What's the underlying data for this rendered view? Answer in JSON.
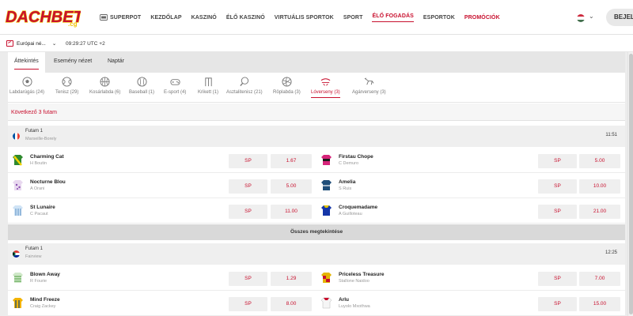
{
  "brand": {
    "logo_text": "DACHBET",
    "logo_suffix": ".cg",
    "accent": "#c8102e"
  },
  "nav": [
    {
      "label": "SUPERPOT",
      "icon": "jackpot-icon"
    },
    {
      "label": "KEZDŐLAP"
    },
    {
      "label": "KASZINÓ"
    },
    {
      "label": "ÉLŐ KASZINÓ"
    },
    {
      "label": "VIRTUÁLIS SPORTOK"
    },
    {
      "label": "SPORT"
    },
    {
      "label": "ÉLŐ FOGADÁS",
      "active": true
    },
    {
      "label": "ESPORTOK"
    },
    {
      "label": "PROMÓCIÓK",
      "promo": true
    }
  ],
  "login_label": "BEJEL",
  "region": {
    "label": "Európai né...",
    "chevron": "⌄"
  },
  "clock": "09:29:27 UTC +2",
  "tabs": [
    "Áttekintés",
    "Esemény nézet",
    "Naptár"
  ],
  "sports": [
    {
      "label": "Labdarúgás (24)",
      "icon": "football-icon"
    },
    {
      "label": "Tenisz (29)",
      "icon": "tennis-icon"
    },
    {
      "label": "Kosárlabda (6)",
      "icon": "basketball-icon"
    },
    {
      "label": "Baseball (1)",
      "icon": "baseball-icon"
    },
    {
      "label": "E-sport (4)",
      "icon": "gamepad-icon"
    },
    {
      "label": "Krikett (1)",
      "icon": "cricket-icon"
    },
    {
      "label": "Asztalitenisz (21)",
      "icon": "table-tennis-icon"
    },
    {
      "label": "Röplabda (3)",
      "icon": "volleyball-icon"
    },
    {
      "label": "Lóverseny (3)",
      "icon": "horse-racing-icon",
      "active": true
    },
    {
      "label": "Agárverseny (3)",
      "icon": "greyhound-icon"
    }
  ],
  "next_label": "Következő 3 futam",
  "show_all_label": "Összes megtekintése",
  "races": [
    {
      "title": "Futam 1",
      "venue": "Marseille-Borely",
      "time": "11:51",
      "flag": "france-flag-icon",
      "rows": [
        {
          "left": {
            "name": "Charming Cat",
            "jockey": "H Boutin",
            "sp": "SP",
            "odds": "1.67",
            "silk": "silk-icon"
          },
          "right": {
            "name": "Firstau Chope",
            "jockey": "C Demuro",
            "sp": "SP",
            "odds": "5.00",
            "silk": "silk-icon"
          }
        },
        {
          "left": {
            "name": "Nocturne Blou",
            "jockey": "A Orani",
            "sp": "SP",
            "odds": "5.00",
            "silk": "silk-icon"
          },
          "right": {
            "name": "Amelia",
            "jockey": "S Ruis",
            "sp": "SP",
            "odds": "10.00",
            "silk": "silk-icon"
          }
        },
        {
          "left": {
            "name": "St Lunaire",
            "jockey": "C Pacaut",
            "sp": "SP",
            "odds": "11.00",
            "silk": "silk-icon"
          },
          "right": {
            "name": "Croquemadame",
            "jockey": "A Guilloteau",
            "sp": "SP",
            "odds": "21.00",
            "silk": "silk-icon"
          }
        }
      ]
    },
    {
      "title": "Futam 1",
      "venue": "Fairview",
      "time": "12:25",
      "flag": "south-africa-flag-icon",
      "rows": [
        {
          "left": {
            "name": "Blown Away",
            "jockey": "R Fourie",
            "sp": "SP",
            "odds": "1.29",
            "silk": "silk-icon"
          },
          "right": {
            "name": "Priceless Treasure",
            "jockey": "Stallone Naidoo",
            "sp": "SP",
            "odds": "7.00",
            "silk": "silk-icon"
          }
        },
        {
          "left": {
            "name": "Mind Freeze",
            "jockey": "Craig Zackey",
            "sp": "SP",
            "odds": "8.00",
            "silk": "silk-icon"
          },
          "right": {
            "name": "Arlu",
            "jockey": "Luyolo Mxothwa",
            "sp": "SP",
            "odds": "15.00",
            "silk": "silk-icon"
          }
        }
      ]
    }
  ]
}
